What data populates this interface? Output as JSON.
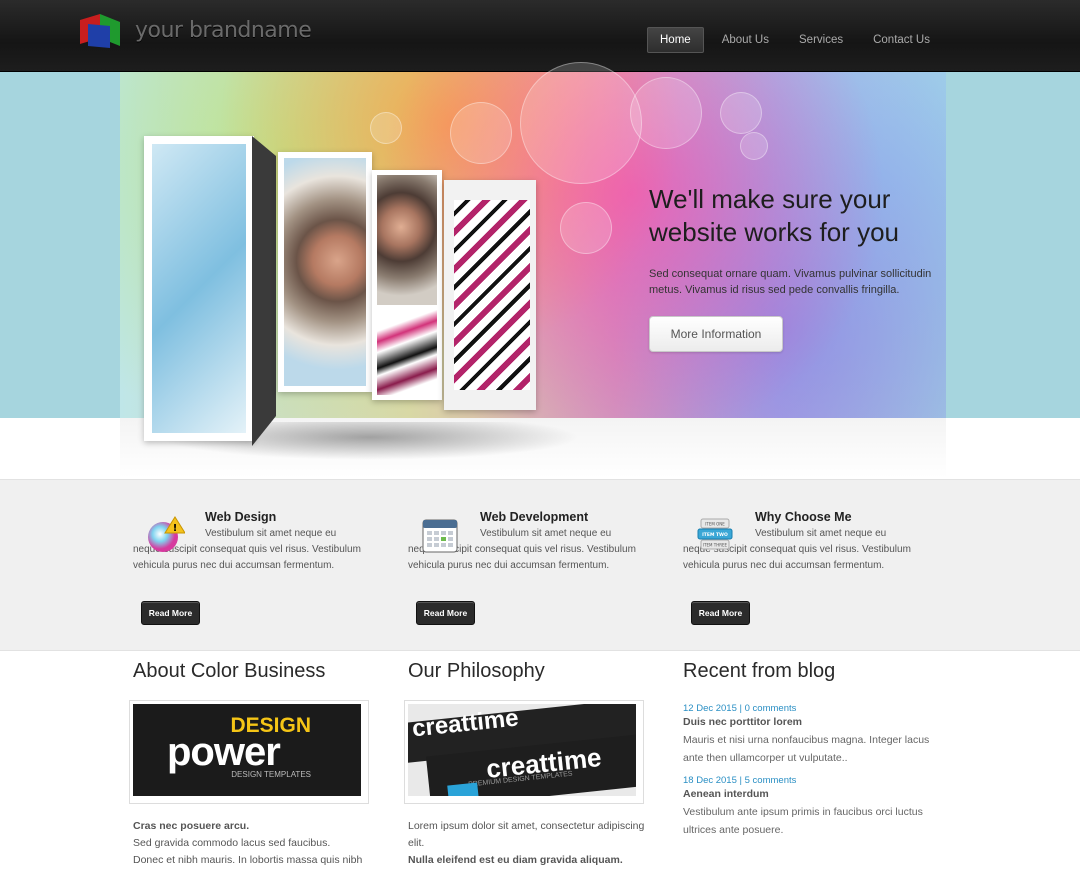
{
  "brand": {
    "name": "your brandname"
  },
  "nav": [
    {
      "label": "Home",
      "active": true
    },
    {
      "label": "About Us",
      "active": false
    },
    {
      "label": "Services",
      "active": false
    },
    {
      "label": "Contact Us",
      "active": false
    }
  ],
  "hero": {
    "title": "We'll make sure your website works for you",
    "text": "Sed consequat ornare quam. Vivamus pulvinar sollicitudin metus. Vivamus id risus sed pede convallis fringilla.",
    "button": "More Information"
  },
  "features": [
    {
      "title": "Web Design",
      "text": "Vestibulum sit amet neque eu neque suscipit consequat quis vel risus. Vestibulum vehicula purus nec dui accumsan fermentum.",
      "button": "Read More",
      "icon": "palette-icon"
    },
    {
      "title": "Web Development",
      "text": "Vestibulum sit amet neque eu neque suscipit consequat quis vel risus. Vestibulum vehicula purus nec dui accumsan fermentum.",
      "button": "Read More",
      "icon": "calendar-icon"
    },
    {
      "title": "Why Choose Me",
      "text": "Vestibulum sit amet neque eu neque suscipit consequat quis vel risus. Vestibulum vehicula purus nec dui accumsan fermentum.",
      "button": "Read More",
      "icon": "list-menu-icon",
      "icon_labels": [
        "ITEM ONE",
        "ITEM TWO",
        "ITEM THREE"
      ]
    }
  ],
  "about": {
    "title": "About Color Business",
    "image": {
      "line1": "DESIGN",
      "line2": "power",
      "line3": "DESIGN TEMPLATES"
    },
    "text_bold": "Cras nec posuere arcu.",
    "text1": "Sed gravida commodo lacus sed faucibus.",
    "text2": "Donec et nibh mauris. In lobortis massa quis nibh"
  },
  "philosophy": {
    "title": "Our Philosophy",
    "image": {
      "word": "creattime",
      "sub": "PREMIUM DESIGN TEMPLATES"
    },
    "text1": "Lorem ipsum dolor sit amet, consectetur adipiscing elit.",
    "text_bold": "Nulla eleifend est eu diam gravida aliquam."
  },
  "blog": {
    "title": "Recent from blog",
    "posts": [
      {
        "date": "12 Dec 2015",
        "comments": "0 comments",
        "title": "Duis nec porttitor lorem",
        "body": "Mauris et nisi urna nonfaucibus magna. Integer lacus ante then ullamcorper ut vulputate.."
      },
      {
        "date": "18 Dec 2015",
        "comments": "5 comments",
        "title": "Aenean interdum",
        "body": "Vestibulum ante ipsum primis in faucibus orci luctus ultrices ante posuere."
      }
    ]
  },
  "colors": {
    "accent_link": "#2a8fc4",
    "dark_button": "#2b2b2b",
    "header_bg": "#1a1a1a"
  }
}
